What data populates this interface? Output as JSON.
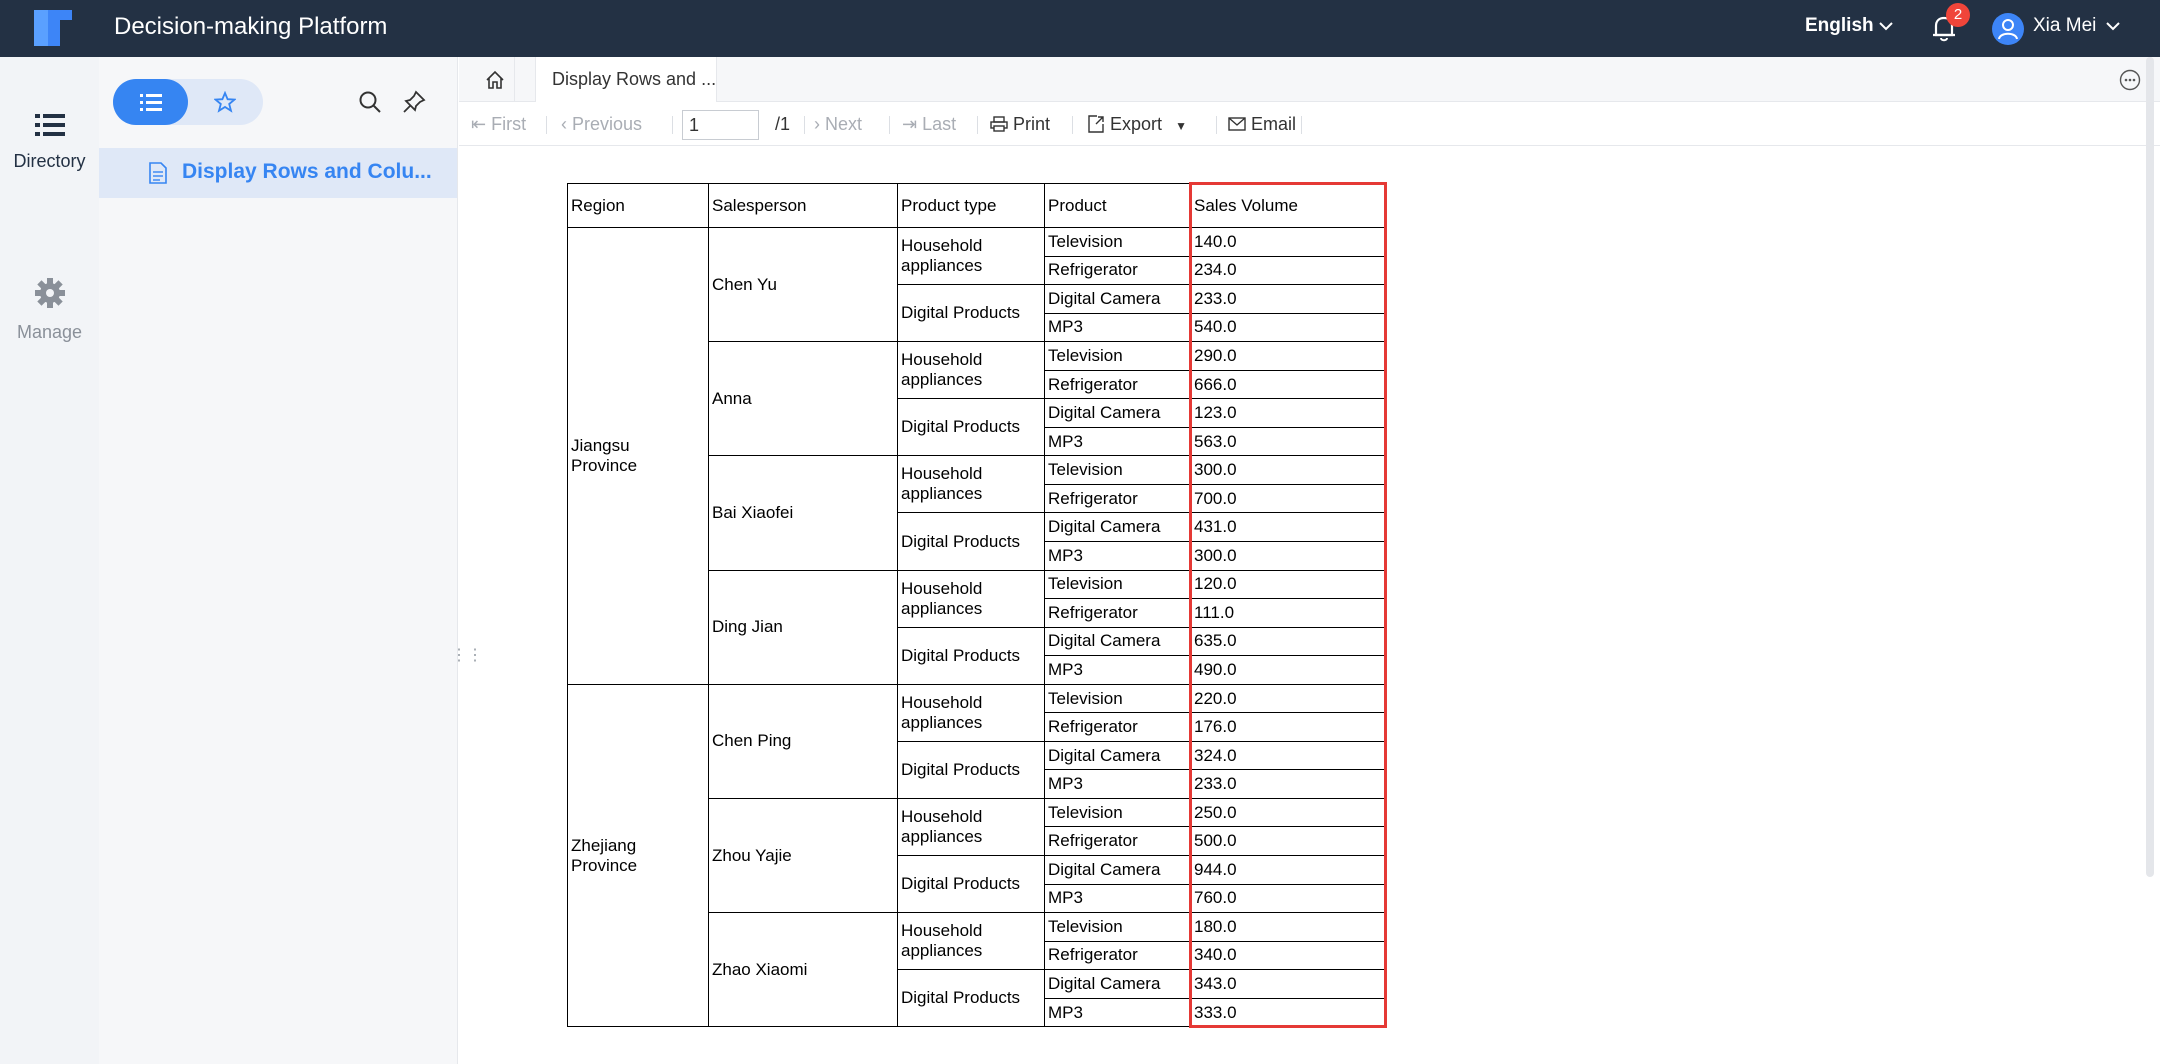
{
  "app": {
    "title": "Decision-making Platform",
    "language": "English",
    "notification_count": "2",
    "user_name": "Xia Mei"
  },
  "nav": {
    "directory": "Directory",
    "manage": "Manage"
  },
  "panel": {
    "tree_item": "Display Rows and Colu..."
  },
  "tabs": {
    "active_tab": "Display Rows and ..."
  },
  "toolbar": {
    "first": "First",
    "previous": "Previous",
    "page_value": "1",
    "page_total": "/1",
    "next": "Next",
    "last": "Last",
    "print": "Print",
    "export": "Export",
    "email": "Email"
  },
  "report": {
    "headers": [
      "Region",
      "Salesperson",
      "Product type",
      "Product",
      "Sales Volume"
    ],
    "regions": [
      {
        "name": "Jiangsu\nProvince",
        "salespeople": [
          {
            "name": "Chen Yu",
            "groups": [
              {
                "type": "Household\nappliances",
                "items": [
                  [
                    "Television",
                    "140.0"
                  ],
                  [
                    "Refrigerator",
                    "234.0"
                  ]
                ]
              },
              {
                "type": "Digital Products",
                "items": [
                  [
                    "Digital Camera",
                    "233.0"
                  ],
                  [
                    "MP3",
                    "540.0"
                  ]
                ]
              }
            ]
          },
          {
            "name": "Anna",
            "groups": [
              {
                "type": "Household\nappliances",
                "items": [
                  [
                    "Television",
                    "290.0"
                  ],
                  [
                    "Refrigerator",
                    "666.0"
                  ]
                ]
              },
              {
                "type": "Digital Products",
                "items": [
                  [
                    "Digital Camera",
                    "123.0"
                  ],
                  [
                    "MP3",
                    "563.0"
                  ]
                ]
              }
            ]
          },
          {
            "name": "Bai Xiaofei",
            "groups": [
              {
                "type": "Household\nappliances",
                "items": [
                  [
                    "Television",
                    "300.0"
                  ],
                  [
                    "Refrigerator",
                    "700.0"
                  ]
                ]
              },
              {
                "type": "Digital Products",
                "items": [
                  [
                    "Digital Camera",
                    "431.0"
                  ],
                  [
                    "MP3",
                    "300.0"
                  ]
                ]
              }
            ]
          },
          {
            "name": "Ding Jian",
            "groups": [
              {
                "type": "Household\nappliances",
                "items": [
                  [
                    "Television",
                    "120.0"
                  ],
                  [
                    "Refrigerator",
                    "111.0"
                  ]
                ]
              },
              {
                "type": "Digital Products",
                "items": [
                  [
                    "Digital Camera",
                    "635.0"
                  ],
                  [
                    "MP3",
                    "490.0"
                  ]
                ]
              }
            ]
          }
        ]
      },
      {
        "name": "Zhejiang\nProvince",
        "salespeople": [
          {
            "name": "Chen Ping",
            "groups": [
              {
                "type": "Household\nappliances",
                "items": [
                  [
                    "Television",
                    "220.0"
                  ],
                  [
                    "Refrigerator",
                    "176.0"
                  ]
                ]
              },
              {
                "type": "Digital Products",
                "items": [
                  [
                    "Digital Camera",
                    "324.0"
                  ],
                  [
                    "MP3",
                    "233.0"
                  ]
                ]
              }
            ]
          },
          {
            "name": "Zhou Yajie",
            "groups": [
              {
                "type": "Household\nappliances",
                "items": [
                  [
                    "Television",
                    "250.0"
                  ],
                  [
                    "Refrigerator",
                    "500.0"
                  ]
                ]
              },
              {
                "type": "Digital Products",
                "items": [
                  [
                    "Digital Camera",
                    "944.0"
                  ],
                  [
                    "MP3",
                    "760.0"
                  ]
                ]
              }
            ]
          },
          {
            "name": "Zhao Xiaomi",
            "groups": [
              {
                "type": "Household\nappliances",
                "items": [
                  [
                    "Television",
                    "180.0"
                  ],
                  [
                    "Refrigerator",
                    "340.0"
                  ]
                ]
              },
              {
                "type": "Digital Products",
                "items": [
                  [
                    "Digital Camera",
                    "343.0"
                  ],
                  [
                    "MP3",
                    "333.0"
                  ]
                ]
              }
            ]
          }
        ]
      }
    ]
  },
  "colors": {
    "topbar": "#233144",
    "accent": "#3685f2",
    "highlight": "#e53935",
    "badge": "#f0453a"
  }
}
